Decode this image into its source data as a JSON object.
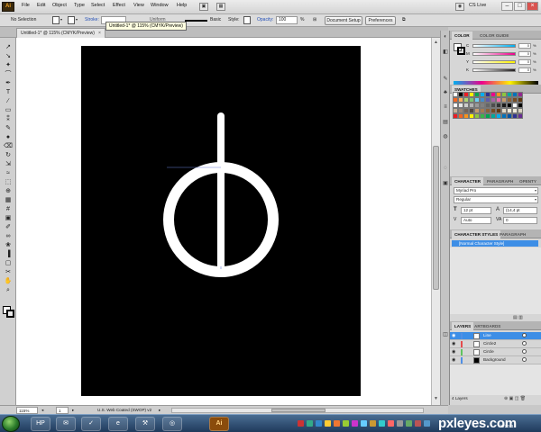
{
  "app": {
    "logo_text": "Ai",
    "menu": [
      "File",
      "Edit",
      "Object",
      "Type",
      "Select",
      "Effect",
      "View",
      "Window",
      "Help"
    ],
    "cs_live": "CS Live",
    "window_buttons": [
      "–",
      "□",
      "×"
    ]
  },
  "control_bar": {
    "selection": "No Selection",
    "stroke_label": "Stroke:",
    "stroke_weight": "",
    "uniform": "Uniform",
    "basic": "Basic",
    "style_label": "Style:",
    "opacity_label": "Opacity:",
    "opacity_value": "100",
    "opacity_unit": "%",
    "document_setup": "Document Setup",
    "preferences": "Preferences"
  },
  "tooltip": "Untitled-1* @ 115% (CMYK/Preview)",
  "document_tab": {
    "title": "Untitled-1* @ 115% (CMYK/Preview)",
    "close": "×"
  },
  "panels": {
    "color": {
      "tabs": [
        "COLOR",
        "COLOR GUIDE"
      ],
      "channels": [
        {
          "name": "C",
          "value": "0",
          "color": "#00aeef"
        },
        {
          "name": "M",
          "value": "0",
          "color": "#ec008c"
        },
        {
          "name": "Y",
          "value": "0",
          "color": "#fff200"
        },
        {
          "name": "K",
          "value": "0",
          "color": "#231f20"
        }
      ],
      "percent": "%"
    },
    "swatches": {
      "tabs": [
        "SWATCHES"
      ]
    },
    "character": {
      "tabs": [
        "CHARACTER",
        "PARAGRAPH",
        "OPENTY"
      ],
      "font": "Myriad Pro",
      "style": "Regular",
      "size": "12 pt",
      "leading": "(14,4 pt",
      "kerning": "Auto",
      "tracking": "0"
    },
    "character_styles": {
      "tabs": [
        "CHARACTER STYLES",
        "PARAGRAPH"
      ],
      "item": "[Normal Character Style]"
    },
    "layers": {
      "tabs": [
        "LAYERS",
        "ARTBOARDS"
      ],
      "rows": [
        {
          "name": "Line",
          "selected": true,
          "color": "#4f8fe6"
        },
        {
          "name": "Circle2",
          "selected": false,
          "color": "#e44c4c"
        },
        {
          "name": "Circle",
          "selected": false,
          "color": "#5fc45f"
        },
        {
          "name": "Background",
          "selected": false,
          "color": "#4f8fe6"
        }
      ],
      "count": "4 Layers"
    }
  },
  "status_bar": {
    "zoom": "115%",
    "page": "1",
    "profile": "U.S. Web Coated (SWOP) v2"
  },
  "taskbar": {
    "apps": [
      "HP",
      "✉",
      "✓",
      "e",
      "⚒",
      "◎",
      "Ai"
    ],
    "watermark": "pxleyes.com",
    "date": "7/6/2011"
  },
  "colors": {
    "artboard": "#000000",
    "glyph": "#ffffff",
    "selection_blue": "#3d8ee6"
  },
  "tools": {
    "icons": [
      "selection-icon",
      "direct-selection-icon",
      "magic-wand-icon",
      "lasso-icon",
      "pen-icon",
      "type-icon",
      "line-segment-icon",
      "rectangle-icon",
      "paintbrush-icon",
      "pencil-icon",
      "blob-brush-icon",
      "eraser-icon",
      "rotate-icon",
      "scale-icon",
      "width-icon",
      "free-transform-icon",
      "shape-builder-icon",
      "perspective-grid-icon",
      "mesh-icon",
      "gradient-icon",
      "eyedropper-icon",
      "blend-icon",
      "symbol-sprayer-icon",
      "column-graph-icon",
      "artboard-icon",
      "slice-icon",
      "hand-icon",
      "zoom-icon"
    ],
    "glyphs": [
      "↗",
      "↘",
      "✦",
      "⌒",
      "✒",
      "T",
      "∕",
      "▭",
      "⁑",
      "✎",
      "●",
      "⌫",
      "↻",
      "⇲",
      "≈",
      "⬚",
      "⊕",
      "▦",
      "#",
      "▣",
      "✐",
      "∞",
      "❀",
      "▐",
      "▢",
      "✂",
      "✋",
      "⌕"
    ]
  }
}
